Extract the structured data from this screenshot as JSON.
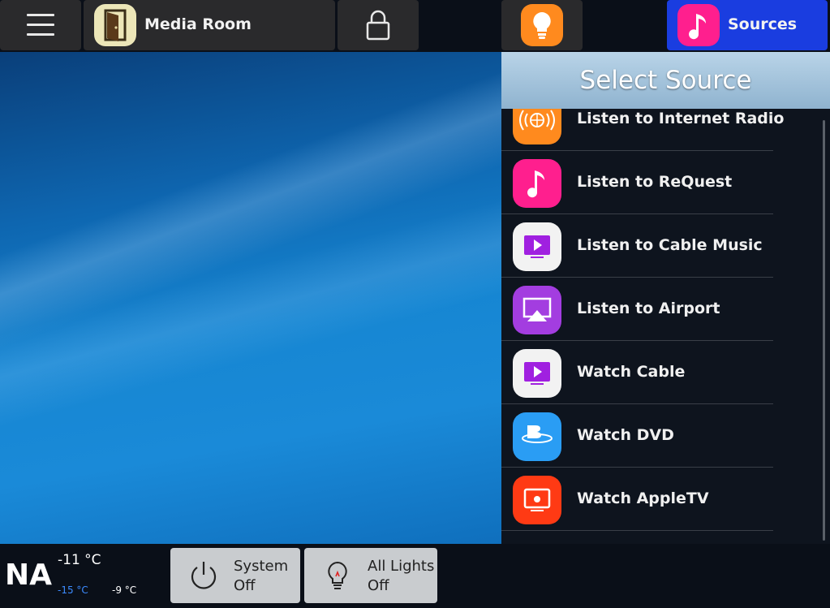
{
  "topbar": {
    "room_label": "Media Room",
    "sources_label": "Sources",
    "menu_icon": "hamburger-menu-icon",
    "room_icon": "door-icon",
    "lock_icon": "lock-icon",
    "lights_icon": "light-bulb-icon",
    "sources_icon": "music-note-icon"
  },
  "panel": {
    "title": "Select Source",
    "items": [
      {
        "label": "Listen to Internet Radio",
        "icon": "internet-radio-icon",
        "color": "#ff8a1e"
      },
      {
        "label": "Listen to ReQuest",
        "icon": "music-note-icon",
        "color": "#ff1f8e"
      },
      {
        "label": "Listen to Cable Music",
        "icon": "tv-play-icon",
        "color": "#f2f2f2"
      },
      {
        "label": "Listen to Airport",
        "icon": "airplay-icon",
        "color": "#a33de0"
      },
      {
        "label": "Watch Cable",
        "icon": "tv-play-icon",
        "color": "#f2f2f2"
      },
      {
        "label": "Watch DVD",
        "icon": "bluray-disc-icon",
        "color": "#2a9df4"
      },
      {
        "label": "Watch AppleTV",
        "icon": "appletv-icon",
        "color": "#ff3a14"
      }
    ]
  },
  "status": {
    "location": "NA",
    "current_temp": "-11 °C",
    "low_temp": "-15 °C",
    "high_temp": "-9 °C"
  },
  "bottom": {
    "system_line1": "System",
    "system_line2": "Off",
    "lights_line1": "All Lights",
    "lights_line2": "Off",
    "system_icon": "power-icon",
    "lights_icon": "light-bulb-icon"
  },
  "colors": {
    "sources_active": "#1a3de0",
    "panel_header": "#a7c5dc",
    "button_gray": "#c9cccf"
  }
}
